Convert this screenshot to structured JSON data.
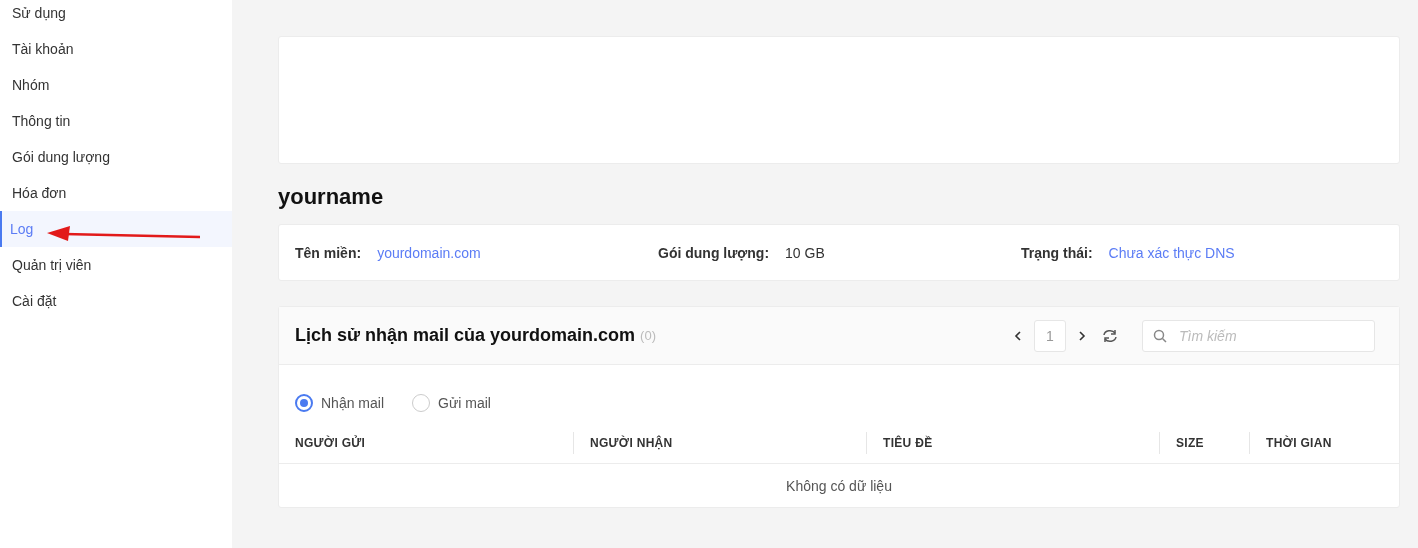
{
  "sidebar": {
    "items": [
      {
        "label": "Sử dụng",
        "selected": false
      },
      {
        "label": "Tài khoản",
        "selected": false
      },
      {
        "label": "Nhóm",
        "selected": false
      },
      {
        "label": "Thông tin",
        "selected": false
      },
      {
        "label": "Gói dung lượng",
        "selected": false
      },
      {
        "label": "Hóa đơn",
        "selected": false
      },
      {
        "label": "Log",
        "selected": true
      },
      {
        "label": "Quản trị viên",
        "selected": false
      },
      {
        "label": "Cài đặt",
        "selected": false
      }
    ]
  },
  "title": "yourname",
  "info": [
    {
      "label": "Tên miền:",
      "value": "yourdomain.com",
      "kind": "link"
    },
    {
      "label": "Gói dung lượng:",
      "value": "10 GB",
      "kind": "plain"
    },
    {
      "label": "Trạng thái:",
      "value": "Chưa xác thực DNS",
      "kind": "link"
    }
  ],
  "log": {
    "title": "Lịch sử nhận mail của yourdomain.com",
    "count": "(0)",
    "page": "1",
    "search": {
      "placeholder": "Tìm kiếm"
    },
    "radios": [
      {
        "label": "Nhận mail",
        "selected": true
      },
      {
        "label": "Gửi mail",
        "selected": false
      }
    ],
    "columns": [
      "NGƯỜI GỬI",
      "NGƯỜI NHẬN",
      "TIÊU ĐỀ",
      "SIZE",
      "THỜI GIAN"
    ],
    "empty": "Không có dữ liệu"
  }
}
